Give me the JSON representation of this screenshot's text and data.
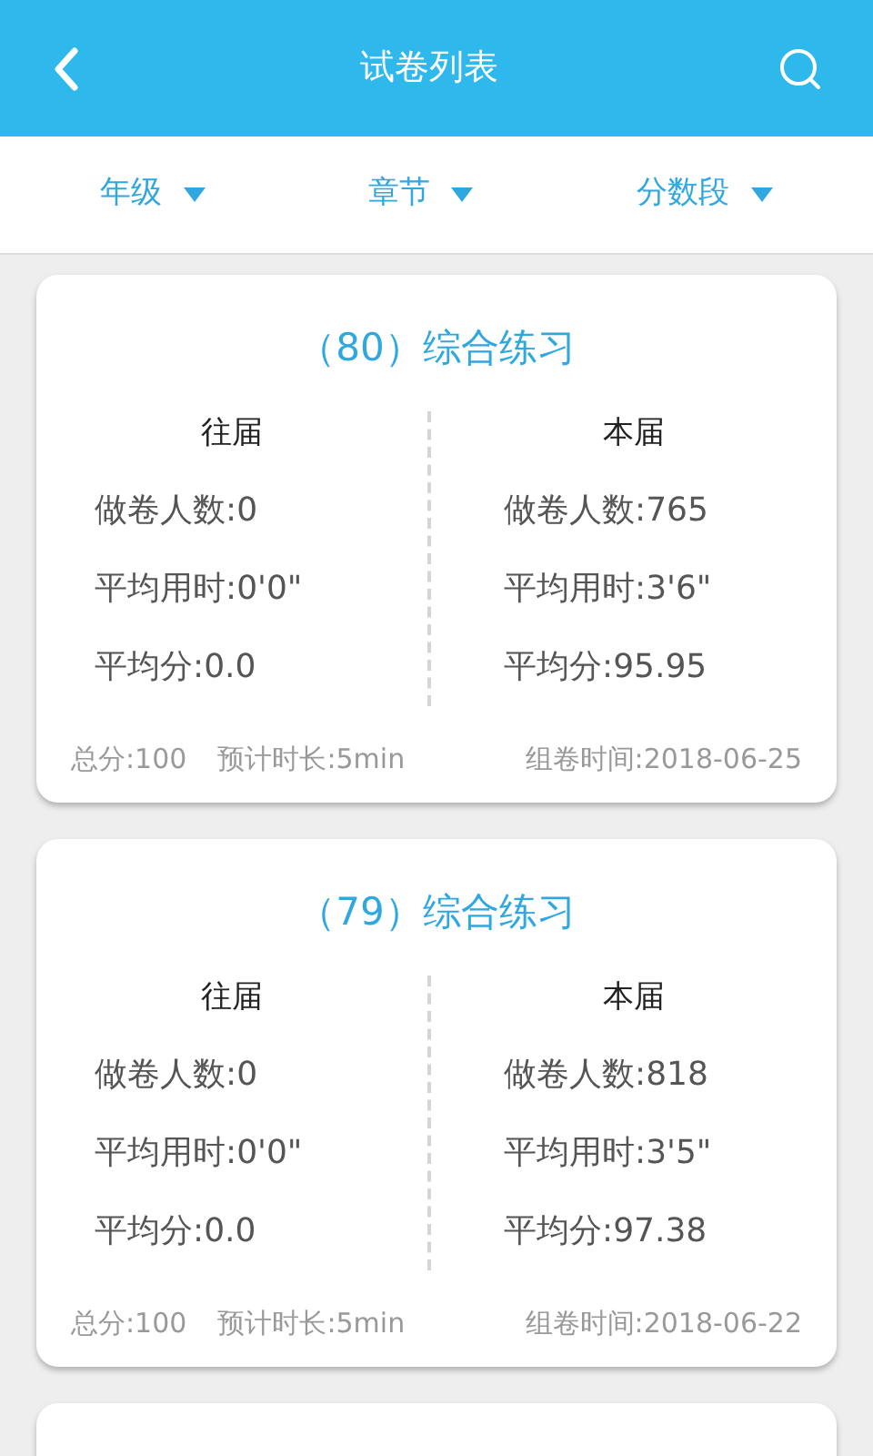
{
  "header": {
    "title": "试卷列表"
  },
  "filters": [
    {
      "label": "年级"
    },
    {
      "label": "章节"
    },
    {
      "label": "分数段"
    }
  ],
  "papers": [
    {
      "title": "（80）综合练习",
      "columns": [
        {
          "heading": "往届",
          "lines": [
            "做卷人数:0",
            "平均用时:0'0\"",
            "平均分:0.0"
          ]
        },
        {
          "heading": "本届",
          "lines": [
            "做卷人数:765",
            "平均用时:3'6\"",
            "平均分:95.95"
          ]
        }
      ],
      "total": "总分:100",
      "duration": "预计时长:5min",
      "created": "组卷时间:2018-06-25"
    },
    {
      "title": "（79）综合练习",
      "columns": [
        {
          "heading": "往届",
          "lines": [
            "做卷人数:0",
            "平均用时:0'0\"",
            "平均分:0.0"
          ]
        },
        {
          "heading": "本届",
          "lines": [
            "做卷人数:818",
            "平均用时:3'5\"",
            "平均分:97.38"
          ]
        }
      ],
      "total": "总分:100",
      "duration": "预计时长:5min",
      "created": "组卷时间:2018-06-22"
    },
    {
      "kind": "partial"
    }
  ]
}
